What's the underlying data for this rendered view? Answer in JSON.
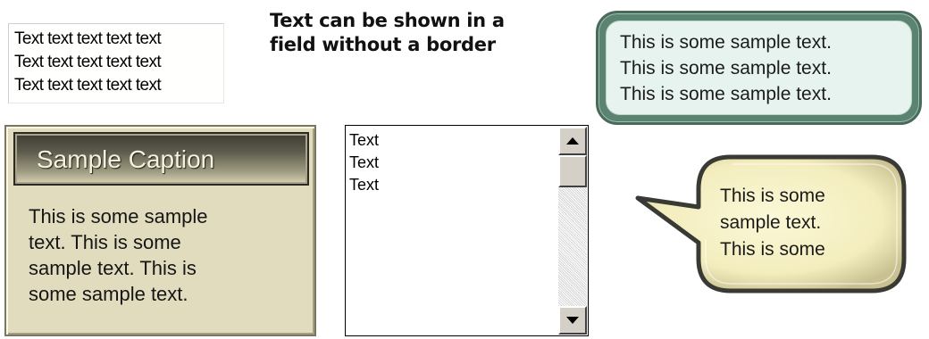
{
  "text_field": {
    "lines": [
      "Text text text text text",
      "Text text text text text",
      "Text text text text text"
    ]
  },
  "borderless_text": {
    "lines": [
      "Text can be shown in a",
      "field without a border"
    ]
  },
  "green_box": {
    "lines": [
      "This is some sample text.",
      "This is some sample text.",
      "This is some sample text."
    ]
  },
  "caption_panel": {
    "title": "Sample Caption",
    "body_lines": [
      "This is some sample",
      "text. This is some",
      "sample text. This is",
      "some sample text."
    ]
  },
  "list_box": {
    "items": [
      "Text",
      "Text",
      "Text"
    ],
    "scroll_up_icon": "triangle-up",
    "scroll_down_icon": "triangle-down"
  },
  "speech_bubble": {
    "lines": [
      "This is some",
      "sample text.",
      "This is some"
    ]
  },
  "colors": {
    "green_box_fill": "#e7f3ee",
    "green_box_border": "#4a6b5c",
    "caption_panel_fill": "#e2dcbe",
    "bubble_fill": "#f6f1c4",
    "bubble_border": "#3a3a35"
  }
}
